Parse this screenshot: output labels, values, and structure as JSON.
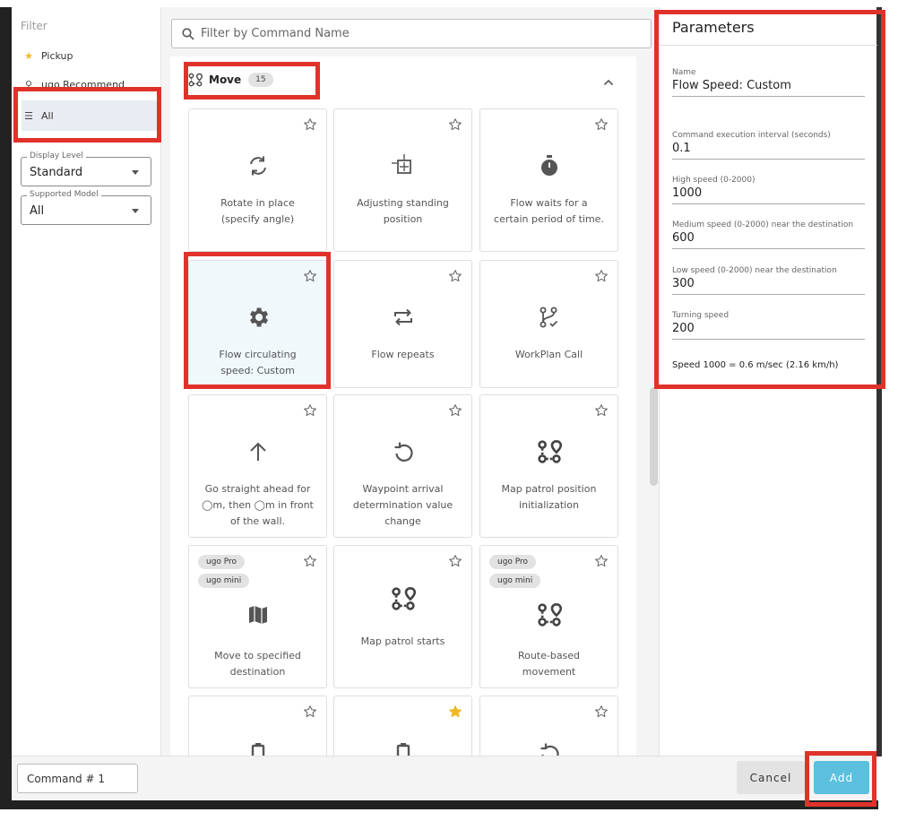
{
  "sidebar": {
    "filter_title": "Filter",
    "items": [
      {
        "label": "Pickup",
        "icon": "star-icon"
      },
      {
        "label": "ugo Recommend",
        "icon": "thumb-icon"
      },
      {
        "label": "All",
        "icon": "list-icon"
      }
    ],
    "display_level": {
      "legend": "Display Level",
      "value": "Standard"
    },
    "supported_model": {
      "legend": "Supported Model",
      "value": "All"
    }
  },
  "search": {
    "placeholder": "Filter by Command Name"
  },
  "section": {
    "title": "Move",
    "count": "15"
  },
  "cards": [
    {
      "label": "Rotate in place (specify angle)",
      "icon": "rotate-icon",
      "starred": false,
      "tags": []
    },
    {
      "label": "Adjusting standing position",
      "icon": "adjust-position-icon",
      "starred": false,
      "tags": []
    },
    {
      "label": "Flow waits for a certain period of time.",
      "icon": "timer-icon",
      "starred": false,
      "tags": []
    },
    {
      "label": "Flow circulating speed: Custom",
      "icon": "gear-icon",
      "starred": false,
      "tags": [],
      "selected": true
    },
    {
      "label": "Flow repeats",
      "icon": "repeat-icon",
      "starred": false,
      "tags": []
    },
    {
      "label": "WorkPlan Call",
      "icon": "branch-icon",
      "starred": false,
      "tags": []
    },
    {
      "label": "Go straight ahead for ◯m, then ◯m in front of the wall.",
      "icon": "arrow-up-icon",
      "starred": false,
      "tags": []
    },
    {
      "label": "Waypoint arrival determination value change",
      "icon": "rotate-left-icon",
      "starred": false,
      "tags": []
    },
    {
      "label": "Map patrol position initialization",
      "icon": "route-icon",
      "starred": false,
      "tags": []
    },
    {
      "label": "Move to specified destination",
      "icon": "map-icon",
      "starred": false,
      "tags": [
        "ugo Pro",
        "ugo mini"
      ]
    },
    {
      "label": "Map patrol starts",
      "icon": "route-icon",
      "starred": false,
      "tags": []
    },
    {
      "label": "Route-based movement",
      "icon": "route-icon",
      "starred": false,
      "tags": [
        "ugo Pro",
        "ugo mini"
      ]
    },
    {
      "label": "",
      "icon": "battery-icon",
      "starred": false,
      "tags": []
    },
    {
      "label": "",
      "icon": "battery-icon",
      "starred": true,
      "tags": []
    },
    {
      "label": "",
      "icon": "rotate-left-icon",
      "starred": false,
      "tags": []
    }
  ],
  "parameters": {
    "title": "Parameters",
    "fields": [
      {
        "label": "Name",
        "value": "Flow Speed: Custom"
      },
      {
        "label": "Command execution interval (seconds)",
        "value": "0.1"
      },
      {
        "label": "High speed (0-2000)",
        "value": "1000"
      },
      {
        "label": "Medium speed (0-2000) near the destination",
        "value": "600"
      },
      {
        "label": "Low speed (0-2000) near the destination",
        "value": "300"
      },
      {
        "label": "Turning speed",
        "value": "200"
      }
    ],
    "note": "Speed 1000 = 0.6 m/sec (2.16 km/h)"
  },
  "footer": {
    "command_name": "Command # 1",
    "cancel_label": "Cancel",
    "add_label": "Add"
  },
  "colors": {
    "accent": "#5bc0de",
    "highlight": "#e0322a",
    "star_filled": "#f2b824"
  }
}
